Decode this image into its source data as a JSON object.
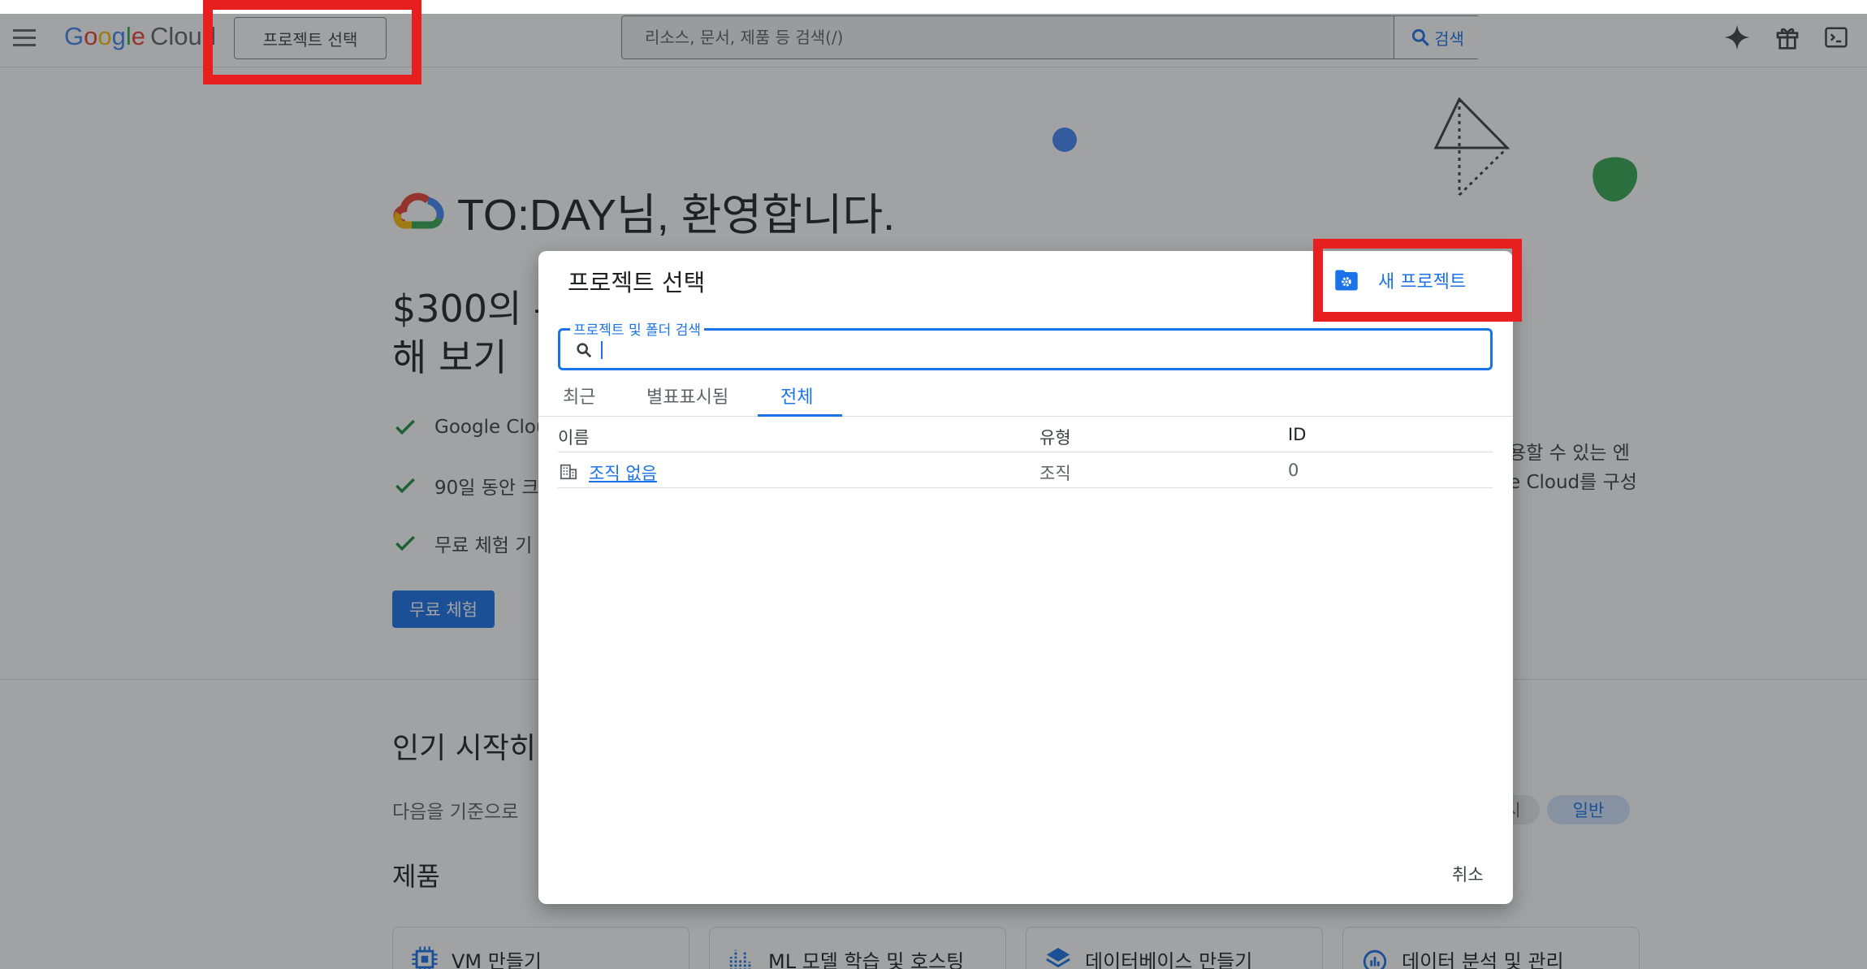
{
  "header": {
    "logo_google": [
      "G",
      "o",
      "o",
      "g",
      "l",
      "e"
    ],
    "logo_cloud": "Cloud",
    "project_select_label": "프로젝트 선택",
    "search_placeholder": "리소스, 문서, 제품 등 검색(/)",
    "search_button_label": "검색"
  },
  "hero": {
    "welcome_title": "TO:DAY님, 환영합니다.",
    "promo_line1": "$300의 -",
    "promo_line2": "해 보기",
    "checks": [
      "Google Clou",
      "90일 동안 크",
      "무료 체험 기"
    ],
    "trial_button_label": "무료 체험",
    "side_line1": "용할 수 있는 엔",
    "side_line2": "e Cloud를 구성"
  },
  "lower": {
    "section_title": "인기 시작히",
    "section_subtitle": "다음을 기준으로",
    "chip_prev": "시",
    "chip_general": "일반",
    "products_title": "제품",
    "cards": [
      "VM 만들기",
      "ML 모델 학습 및 호스팅",
      "데이터베이스 만들기",
      "데이터 분석 및 관리"
    ]
  },
  "dialog": {
    "title": "프로젝트 선택",
    "new_project_label": "새 프로젝트",
    "search_label": "프로젝트 및 폴더 검색",
    "search_value": "",
    "tabs": [
      "최근",
      "별표표시됨",
      "전체"
    ],
    "active_tab": "전체",
    "columns": [
      "이름",
      "유형",
      "ID"
    ],
    "rows": [
      {
        "name": "조직 없음",
        "type": "조직",
        "id": "0"
      }
    ],
    "cancel_label": "취소"
  },
  "colors": {
    "accent": "#1a73e8",
    "highlight": "#e81f1f",
    "scrim": "rgba(32,33,36,0.42)"
  }
}
